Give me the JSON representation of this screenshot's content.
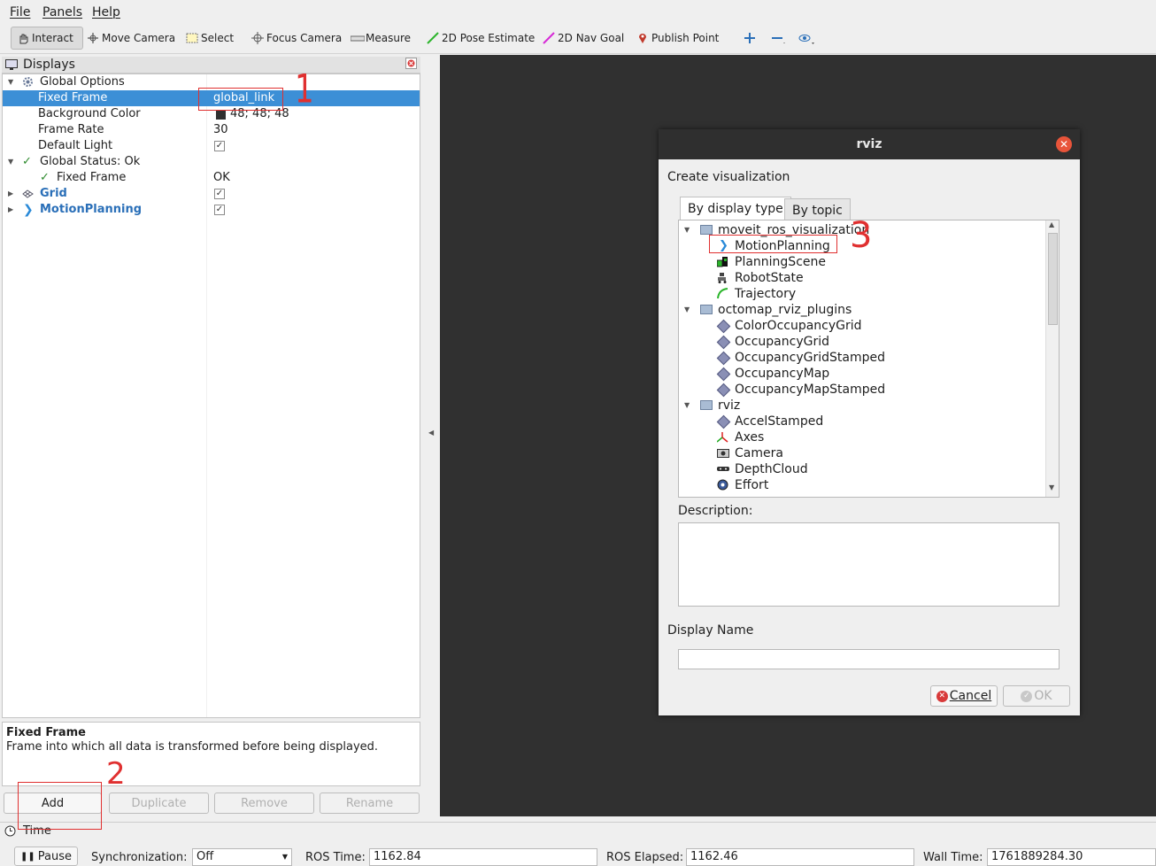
{
  "menu": {
    "file": "File",
    "panels": "Panels",
    "help": "Help"
  },
  "toolbar": {
    "interact": "Interact",
    "move_camera": "Move Camera",
    "select": "Select",
    "focus_camera": "Focus Camera",
    "measure": "Measure",
    "pose_estimate": "2D Pose Estimate",
    "nav_goal": "2D Nav Goal",
    "publish_point": "Publish Point"
  },
  "displays": {
    "title": "Displays",
    "rows": {
      "global_options": "Global Options",
      "fixed_frame": {
        "label": "Fixed Frame",
        "value": "global_link"
      },
      "background_color": {
        "label": "Background Color",
        "value": "48; 48; 48",
        "color": "#303030"
      },
      "frame_rate": {
        "label": "Frame Rate",
        "value": "30"
      },
      "default_light": {
        "label": "Default Light"
      },
      "global_status": "Global Status: Ok",
      "status_fixed_frame": {
        "label": "Fixed Frame",
        "value": "OK"
      },
      "grid": "Grid",
      "motion_planning": "MotionPlanning"
    }
  },
  "description": {
    "title": "Fixed Frame",
    "text": "Frame into which all data is transformed before being displayed."
  },
  "buttons": {
    "add": "Add",
    "duplicate": "Duplicate",
    "remove": "Remove",
    "rename": "Rename"
  },
  "time": {
    "title": "Time",
    "pause": "Pause",
    "sync_label": "Synchronization:",
    "sync_value": "Off",
    "ros_time_label": "ROS Time:",
    "ros_time": "1162.84",
    "ros_elapsed_label": "ROS Elapsed:",
    "ros_elapsed": "1162.46",
    "wall_time_label": "Wall Time:",
    "wall_time": "1761889284.30"
  },
  "dialog": {
    "title": "rviz",
    "heading": "Create visualization",
    "tabs": [
      "By display type",
      "By topic"
    ],
    "groups": [
      {
        "name": "moveit_ros_visualization",
        "items": [
          "MotionPlanning",
          "PlanningScene",
          "RobotState",
          "Trajectory"
        ]
      },
      {
        "name": "octomap_rviz_plugins",
        "items": [
          "ColorOccupancyGrid",
          "OccupancyGrid",
          "OccupancyGridStamped",
          "OccupancyMap",
          "OccupancyMapStamped"
        ]
      },
      {
        "name": "rviz",
        "items": [
          "AccelStamped",
          "Axes",
          "Camera",
          "DepthCloud",
          "Effort"
        ]
      }
    ],
    "description_label": "Description:",
    "display_name_label": "Display Name",
    "display_name_value": "",
    "cancel": "Cancel",
    "ok": "OK"
  },
  "annotations": {
    "one": "1",
    "two": "2",
    "three": "3"
  },
  "colors": {
    "selection": "#3c8fd6",
    "viewport": "#303030",
    "annotation": "#e03030",
    "accent_link": "#2a6fb8"
  }
}
